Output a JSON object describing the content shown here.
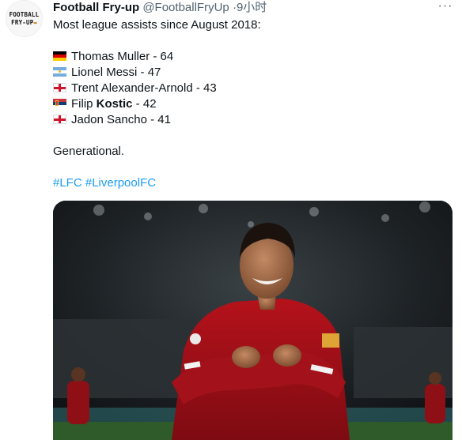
{
  "tweet": {
    "avatar": {
      "line1": "FOOTBALL",
      "line2": "FRY-UP"
    },
    "author_name": "Football Fry-up",
    "author_handle": "@FootballFryUp",
    "separator": "·",
    "timestamp": "9小时",
    "more_icon": "more-horizontal-icon",
    "intro": "Most league assists since August 2018:",
    "assists": [
      {
        "flag": "germany-flag-icon",
        "text": "Thomas Muller - 64"
      },
      {
        "flag": "argentina-flag-icon",
        "text": "Lionel Messi - 47"
      },
      {
        "flag": "england-flag-icon",
        "text": "Trent Alexander-Arnold - 43"
      },
      {
        "flag": "serbia-flag-icon",
        "first": "Filip ",
        "bold": "Kostic",
        "rest": " - 42"
      },
      {
        "flag": "england-flag-icon",
        "text": "Jadon Sancho - 41"
      }
    ],
    "closing": "Generational.",
    "hashtags": [
      "#LFC",
      "#LiverpoolFC"
    ]
  }
}
